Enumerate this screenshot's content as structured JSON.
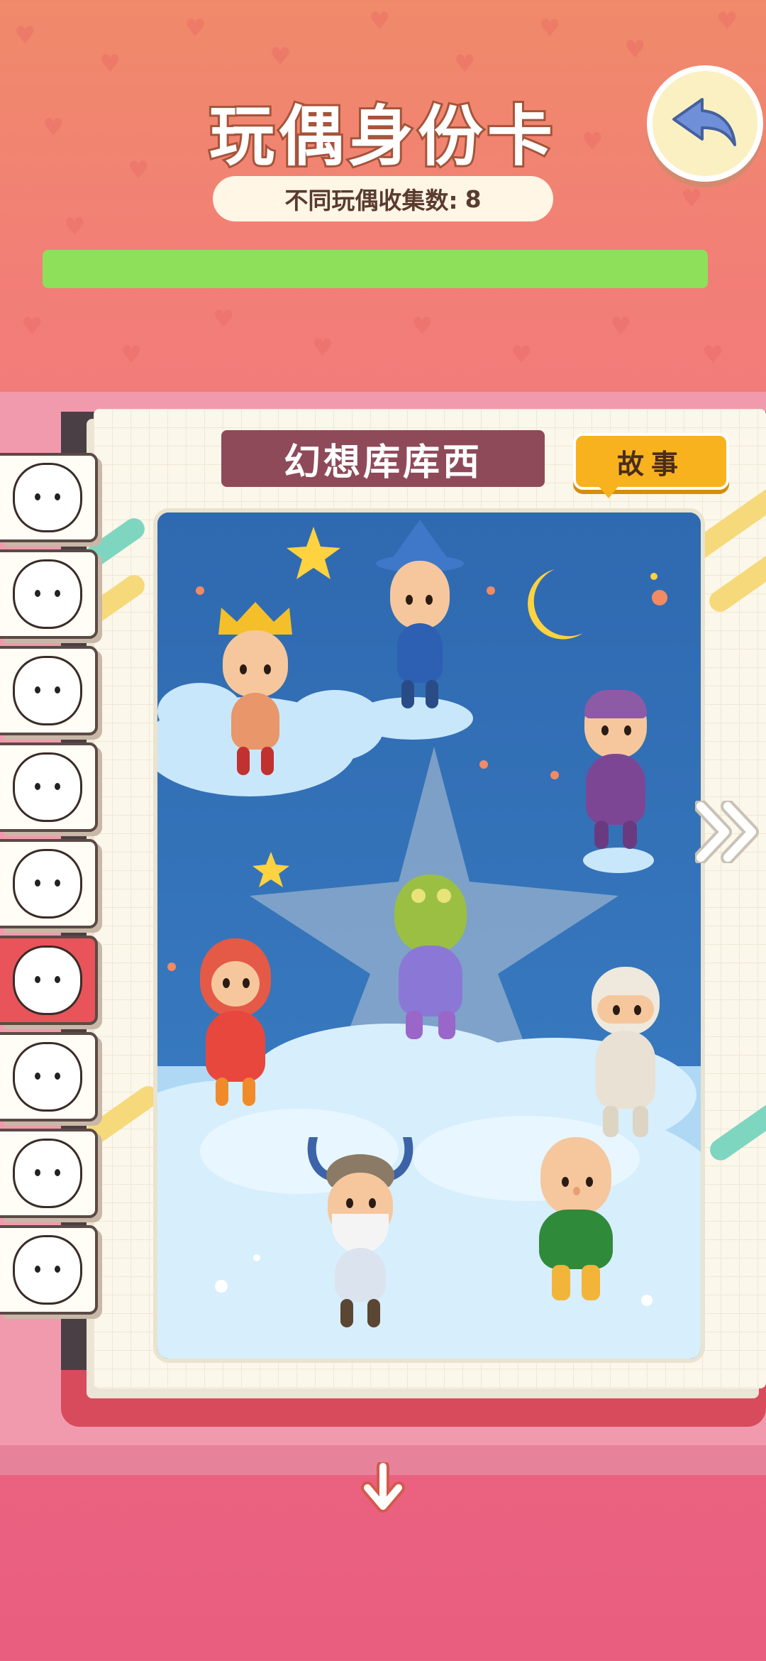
{
  "header": {
    "title_part1": "玩偶",
    "title_part2": "身份卡",
    "count_label": "不同玩偶收集数:",
    "count_value": "8",
    "progress": 1.0
  },
  "book": {
    "series_name": "幻想库库西",
    "story_button": "故事"
  },
  "tabs": [
    {
      "name": "tab-seal",
      "active": false
    },
    {
      "name": "tab-bear",
      "active": false
    },
    {
      "name": "tab-tomato",
      "active": false
    },
    {
      "name": "tab-fox",
      "active": false
    },
    {
      "name": "tab-rabbit-girl",
      "active": false
    },
    {
      "name": "tab-crown",
      "active": true
    },
    {
      "name": "tab-warrior",
      "active": false
    },
    {
      "name": "tab-curly",
      "active": false
    },
    {
      "name": "tab-bunny",
      "active": false
    }
  ],
  "icons": {
    "back": "back-arrow-icon",
    "next": "double-chevron-right-icon",
    "down": "down-arrow-icon"
  },
  "colors": {
    "progress_fill": "#8ee05a",
    "banner": "#8f4a5a",
    "story": "#f7b21e",
    "active_tab": "#e8545a"
  }
}
